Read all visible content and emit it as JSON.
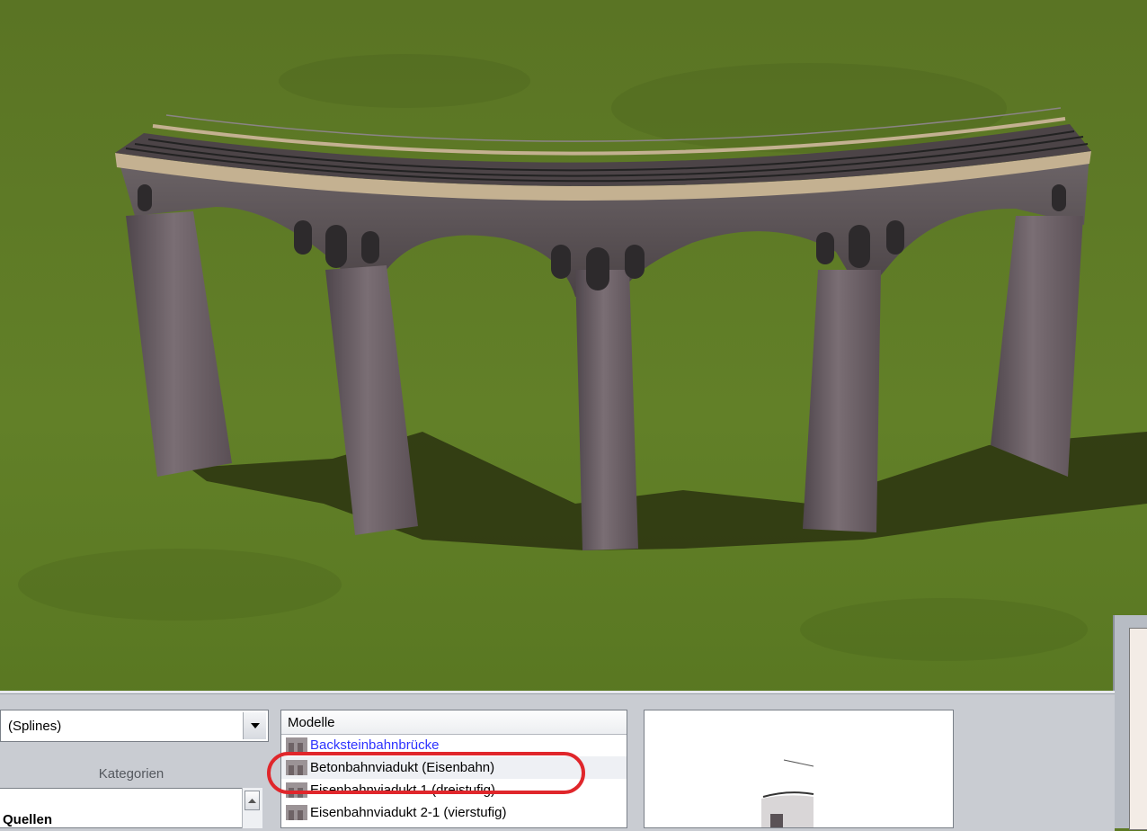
{
  "viewport": {
    "scene": "3d-viaduct",
    "colors": {
      "grass": "#5d7a23",
      "stone": "#6b5f66",
      "shadow": "#2b3310"
    }
  },
  "source_combo": {
    "value": "(Splines)",
    "button_icon": "chevron-down-icon"
  },
  "categories": {
    "label": "Kategorien"
  },
  "tree": {
    "items": [
      "Quellen"
    ]
  },
  "models": {
    "header": "Modelle",
    "items": [
      {
        "label": "Backsteinbahnbrücke",
        "icon": "viaduct-model-icon",
        "color": "#2d33ff"
      },
      {
        "label": "Betonbahnviadukt (Eisenbahn)",
        "icon": "viaduct-model-icon",
        "selected": true
      },
      {
        "label": "Eisenbahnviadukt 1 (dreistufig)",
        "icon": "viaduct-model-icon"
      },
      {
        "label": "Eisenbahnviadukt 2-1 (vierstufig)",
        "icon": "viaduct-model-icon"
      }
    ]
  },
  "annotation": {
    "color": "#e0262b",
    "shape": "rounded-rectangle"
  }
}
